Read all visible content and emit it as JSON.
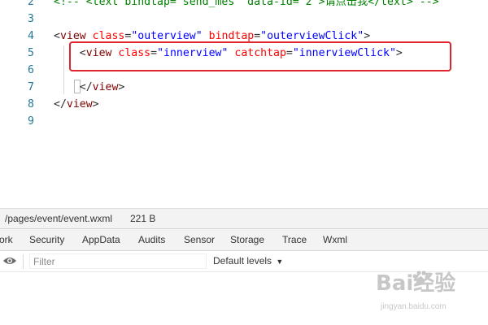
{
  "editor": {
    "lines": [
      {
        "num": "2",
        "tokens": [
          {
            "cls": "t-cmt",
            "text": "<!-- <text bindtap=\"send_mes\" data-id=\"2\">请点击我</text> -->"
          }
        ]
      },
      {
        "num": "3",
        "tokens": []
      },
      {
        "num": "4",
        "tokens": [
          {
            "cls": "t-punc",
            "text": "<"
          },
          {
            "cls": "t-tag",
            "text": "view"
          },
          {
            "cls": "t-punc",
            "text": " "
          },
          {
            "cls": "t-attr",
            "text": "class"
          },
          {
            "cls": "t-punc",
            "text": "="
          },
          {
            "cls": "t-val",
            "text": "\"outerview\""
          },
          {
            "cls": "t-punc",
            "text": " "
          },
          {
            "cls": "t-attr",
            "text": "bindtap"
          },
          {
            "cls": "t-punc",
            "text": "="
          },
          {
            "cls": "t-val",
            "text": "\"outerviewClick\""
          },
          {
            "cls": "t-punc",
            "text": ">"
          }
        ]
      },
      {
        "num": "5",
        "tokens": [
          {
            "cls": "t-punc",
            "text": "    <"
          },
          {
            "cls": "t-tag",
            "text": "view"
          },
          {
            "cls": "t-punc",
            "text": " "
          },
          {
            "cls": "t-attr",
            "text": "class"
          },
          {
            "cls": "t-punc",
            "text": "="
          },
          {
            "cls": "t-val",
            "text": "\"innerview\""
          },
          {
            "cls": "t-punc",
            "text": " "
          },
          {
            "cls": "t-attr",
            "text": "catchtap"
          },
          {
            "cls": "t-punc",
            "text": "="
          },
          {
            "cls": "t-val",
            "text": "\"innerviewClick\""
          },
          {
            "cls": "t-punc",
            "text": ">"
          }
        ]
      },
      {
        "num": "6",
        "tokens": []
      },
      {
        "num": "7",
        "tokens": [
          {
            "cls": "t-punc",
            "text": "    </"
          },
          {
            "cls": "t-tag",
            "text": "view"
          },
          {
            "cls": "t-punc",
            "text": ">"
          }
        ]
      },
      {
        "num": "8",
        "tokens": [
          {
            "cls": "t-punc",
            "text": "</"
          },
          {
            "cls": "t-tag",
            "text": "view"
          },
          {
            "cls": "t-punc",
            "text": ">"
          }
        ]
      },
      {
        "num": "9",
        "tokens": []
      }
    ]
  },
  "statusbar": {
    "file_path": "/pages/event/event.wxml",
    "file_size": "221 B"
  },
  "devtools": {
    "tabs": [
      "ork",
      "Security",
      "AppData",
      "Audits",
      "Sensor",
      "Storage",
      "Trace",
      "Wxml"
    ]
  },
  "console": {
    "filter_placeholder": "Filter",
    "levels_label": "Default levels",
    "levels_arrow": "▼"
  },
  "watermark": {
    "brand": "Bai经验",
    "url": "jingyan.baidu.com"
  },
  "colors": {
    "highlight_border": "#e0242c",
    "line_number": "#237893",
    "tag": "#800000",
    "attribute": "#ff0000",
    "value": "#0000ff",
    "comment": "#008000"
  },
  "icons": [
    "eye-icon",
    "dropdown-arrow-icon",
    "paw-icon"
  ]
}
